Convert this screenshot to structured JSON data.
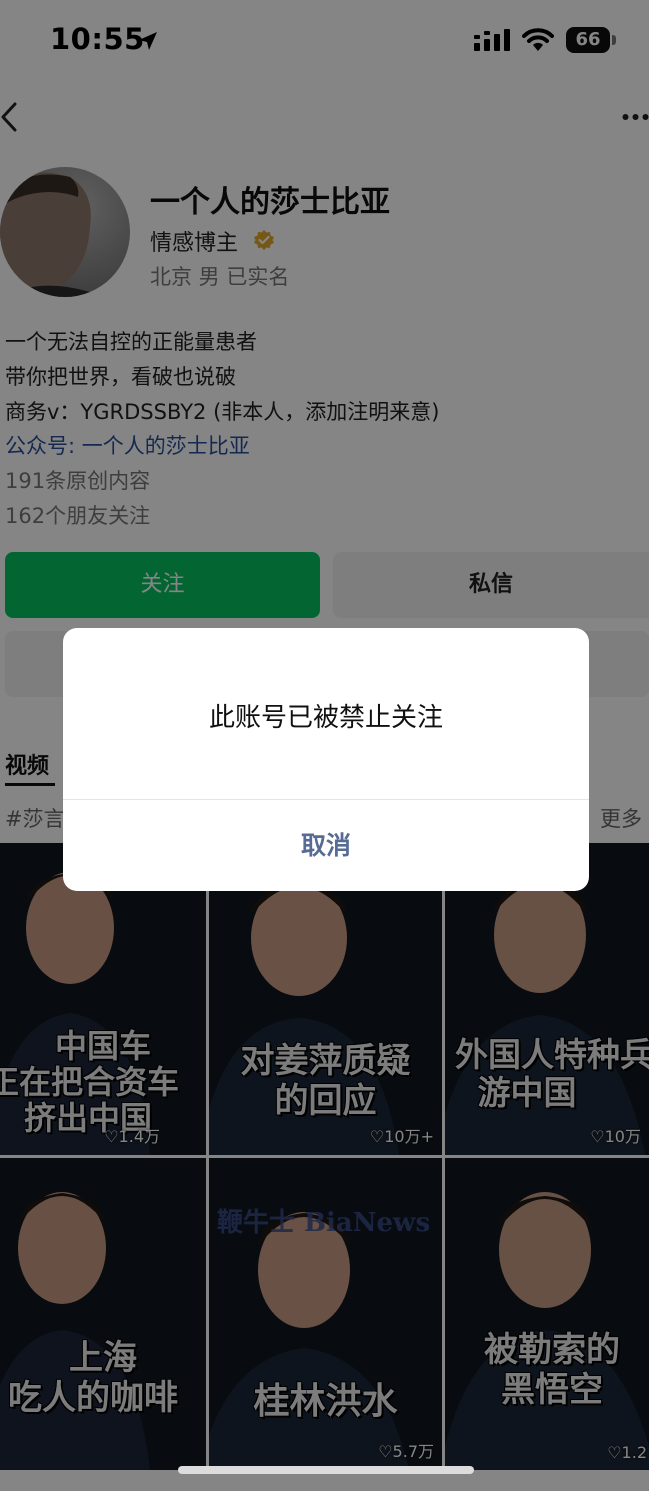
{
  "status_bar": {
    "time": "10:55",
    "battery": "66",
    "icons": [
      "location-arrow-icon",
      "signal-icon",
      "wifi-icon",
      "battery-icon"
    ]
  },
  "nav": {
    "back_icon": "chevron-left-icon",
    "more_icon": "ellipsis-icon"
  },
  "profile": {
    "name": "一个人的莎士比亚",
    "role": "情感博主",
    "meta": "北京 男 已实名",
    "verified_color": "#e2a92b"
  },
  "bio": {
    "line1": "一个无法自控的正能量患者",
    "line2": "带你把世界，看破也说破",
    "line3": "商务v：YGRDSSBY2 (非本人，添加注明来意)",
    "line4": "公众号: 一个人的莎士比亚",
    "original_count": "191条原创内容",
    "friends_following": "162个朋友关注"
  },
  "actions": {
    "follow": "关注",
    "message": "私信"
  },
  "tabs": {
    "video": "视频"
  },
  "topics": {
    "tag": "#莎言",
    "more": "更多"
  },
  "videos": [
    {
      "caption_line1": "中国车",
      "caption_line2": "正在把合资车",
      "caption_line3": "挤出中国",
      "likes": "♡1.4万"
    },
    {
      "caption_line1": "对姜萍质疑",
      "caption_line2": "的回应",
      "caption_line3": "",
      "likes": "♡10万+"
    },
    {
      "caption_line1": "外国人特种兵",
      "caption_line2": "游中国",
      "caption_line3": "",
      "likes": "♡10万"
    },
    {
      "caption_line1": "上海",
      "caption_line2": "吃人的咖啡",
      "caption_line3": "",
      "likes": ""
    },
    {
      "caption_line1": "桂林洪水",
      "caption_line2": "",
      "caption_line3": "",
      "likes": "♡5.7万"
    },
    {
      "caption_line1": "被勒索的",
      "caption_line2": "黑悟空",
      "caption_line3": "",
      "likes": "♡1.2"
    }
  ],
  "watermark": "鞭牛士 BiaNews",
  "dialog": {
    "message": "此账号已被禁止关注",
    "cancel": "取消"
  },
  "colors": {
    "follow_green": "#07c160",
    "link_blue": "#2a4f9a",
    "dialog_action": "#576b95"
  }
}
